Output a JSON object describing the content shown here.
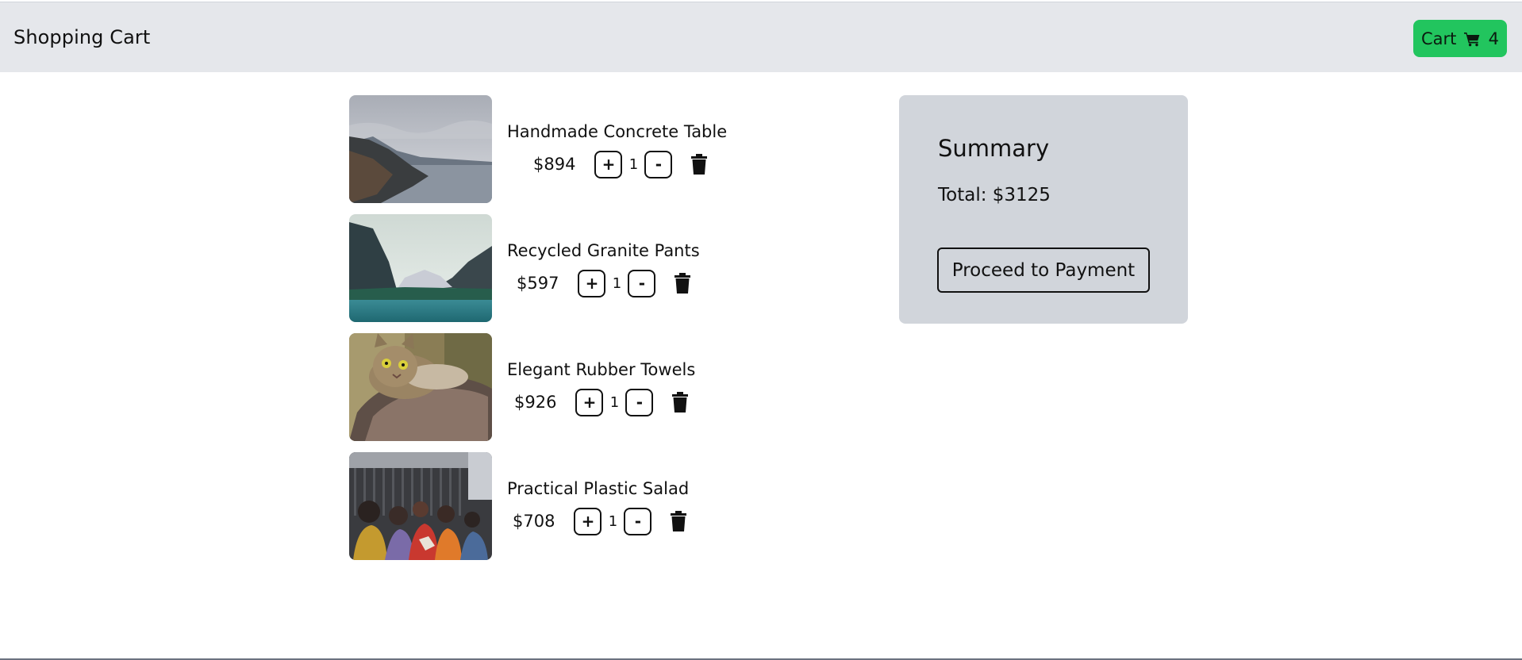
{
  "header": {
    "title": "Shopping Cart",
    "cart_label": "Cart",
    "cart_count": "4",
    "cart_icon": "cart-icon",
    "cart_color": "#22c55e"
  },
  "items": [
    {
      "name": "Handmade Concrete Table",
      "price": "$894",
      "quantity": "1",
      "increment": "+",
      "decrement": "-",
      "image": "mountain-lake-photo"
    },
    {
      "name": "Recycled Granite Pants",
      "price": "$597",
      "quantity": "1",
      "increment": "+",
      "decrement": "-",
      "image": "mountain-valley-lake-photo"
    },
    {
      "name": "Elegant Rubber Towels",
      "price": "$926",
      "quantity": "1",
      "increment": "+",
      "decrement": "-",
      "image": "cat-photo"
    },
    {
      "name": "Practical Plastic Salad",
      "price": "$708",
      "quantity": "1",
      "increment": "+",
      "decrement": "-",
      "image": "crowd-photo"
    }
  ],
  "summary": {
    "title": "Summary",
    "total": "Total: $3125",
    "pay_label": "Proceed to Payment",
    "background": "#d1d5db"
  }
}
